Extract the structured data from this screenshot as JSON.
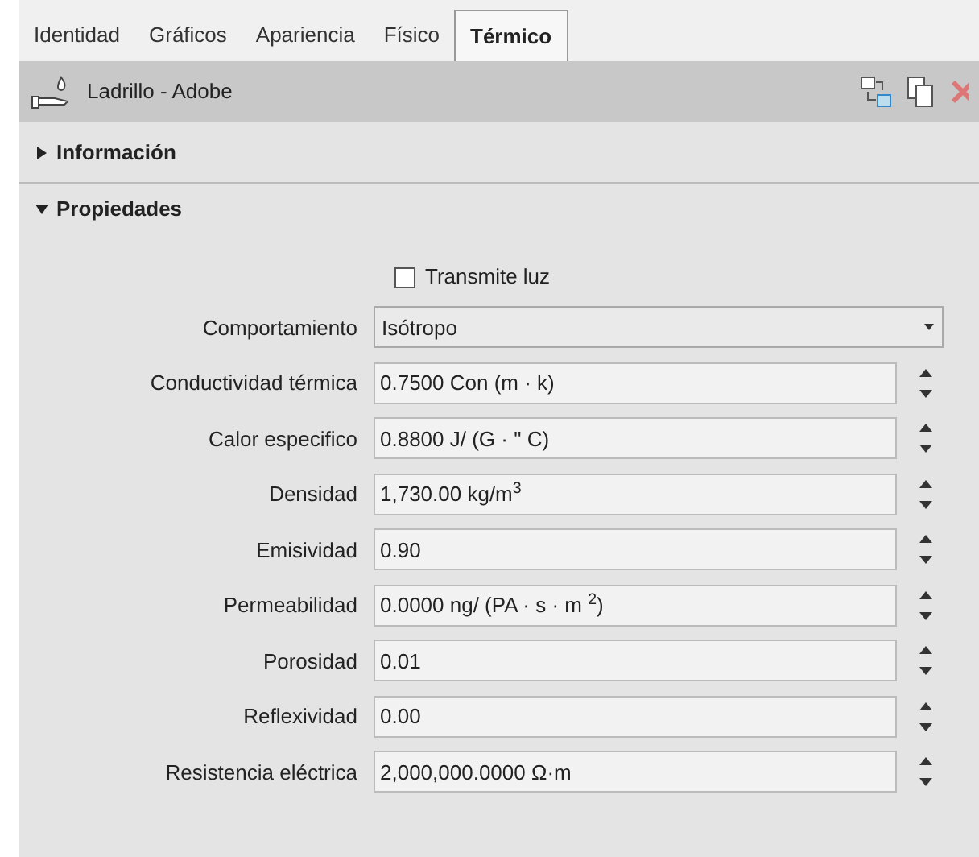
{
  "tabs": [
    {
      "label": "Identidad",
      "selected": false
    },
    {
      "label": "Gráficos",
      "selected": false
    },
    {
      "label": "Apariencia",
      "selected": false
    },
    {
      "label": "Físico",
      "selected": false
    },
    {
      "label": "Térmico",
      "selected": true
    }
  ],
  "header": {
    "title": "Ladrillo - Adobe"
  },
  "sections": [
    {
      "title": "Información",
      "expanded": false
    },
    {
      "title": "Propiedades",
      "expanded": true
    }
  ],
  "transmits_light": {
    "label": "Transmite luz",
    "checked": false
  },
  "properties": [
    {
      "kind": "dropdown",
      "label": "Comportamiento",
      "value": "Isótropo"
    },
    {
      "kind": "spinner",
      "label": "Conductividad térmica",
      "value": "0.7500 Con (m · k)"
    },
    {
      "kind": "spinner",
      "label": "Calor especifico",
      "value": "0.8800 J/ (G · \" C)"
    },
    {
      "kind": "spinner",
      "label": "Densidad",
      "value": "1,730.00 kg/m$^{3}$"
    },
    {
      "kind": "spinner",
      "label": "Emisividad",
      "value": "0.90"
    },
    {
      "kind": "spinner",
      "label": "Permeabilidad",
      "value": "0.0000 ng/ (PA · s · m $^{2}$)"
    },
    {
      "kind": "spinner",
      "label": "Porosidad",
      "value": "0.01"
    },
    {
      "kind": "spinner",
      "label": "Reflexividad",
      "value": "0.00"
    },
    {
      "kind": "spinner",
      "label": "Resistencia eléctrica",
      "value": "2,000,000.0000 Ω·m"
    }
  ]
}
